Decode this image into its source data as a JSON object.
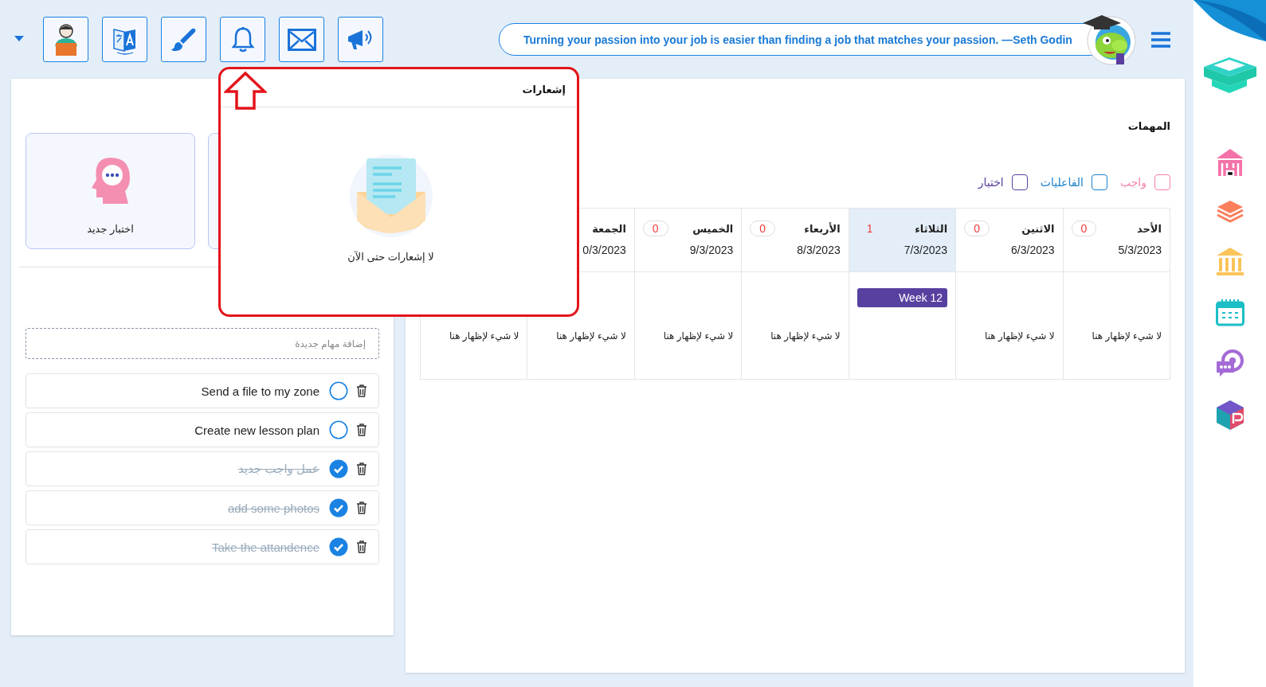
{
  "quote": "Turning your passion into your job is easier than finding a job that matches your passion. —Seth Godin",
  "left_panel": {
    "cards": [
      {
        "label": "اختبار جديد"
      }
    ],
    "new_task_placeholder": "إضافة مهام جديدة",
    "tasks": [
      {
        "text": "Send a file to my zone",
        "done": false
      },
      {
        "text": "Create new lesson plan",
        "done": false
      },
      {
        "text": "عمل واجب جديد",
        "done": true
      },
      {
        "text": "add some photos",
        "done": true
      },
      {
        "text": "Take the attandence",
        "done": true
      }
    ]
  },
  "notifications": {
    "title": "إشعارات",
    "empty_message": "لا إشعارات حتى الآن"
  },
  "tasks_panel": {
    "title": "المهمات",
    "legend": [
      {
        "label": "واجب",
        "color": "#f77fae"
      },
      {
        "label": "الفاعليات",
        "color": "#1b82cc"
      },
      {
        "label": "اختبار",
        "color": "#5a40a0"
      }
    ],
    "days": [
      {
        "name": "الأحد",
        "date": "5/3/2023",
        "count": "0",
        "selected": false,
        "empty": "لا شيء لإظهار هنا"
      },
      {
        "name": "الاثنين",
        "date": "6/3/2023",
        "count": "0",
        "selected": false,
        "empty": "لا شيء لإظهار هنا"
      },
      {
        "name": "الثلاثاء",
        "date": "7/3/2023",
        "count": "1",
        "selected": true,
        "events": [
          "Week 12"
        ]
      },
      {
        "name": "الأربعاء",
        "date": "8/3/2023",
        "count": "0",
        "selected": false,
        "empty": "لا شيء لإظهار هنا"
      },
      {
        "name": "الخميس",
        "date": "9/3/2023",
        "count": "0",
        "selected": false,
        "empty": "لا شيء لإظهار هنا"
      },
      {
        "name": "الجمعة",
        "date": "0/3/2023",
        "selected": false,
        "empty": "لا شيء لإظهار هنا"
      },
      {
        "empty": "لا شيء لإظهار هنا"
      }
    ]
  }
}
